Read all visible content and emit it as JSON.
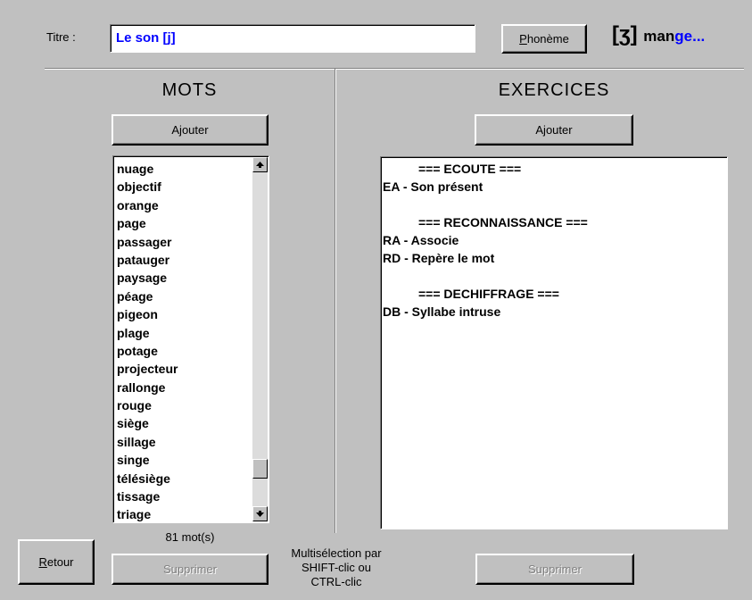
{
  "header": {
    "title_label": "Titre :",
    "title_value": "Le son [j]",
    "phoneme_button": "Phonème",
    "phoneme_symbol": "[ʒ]",
    "example_word_prefix": "man",
    "example_word_highlight": "ge...",
    "highlight_color": "#0000ff"
  },
  "mots": {
    "heading": "MOTS",
    "add_button": "Ajouter",
    "words": [
      "nuage",
      "objectif",
      "orange",
      "page",
      "passager",
      "patauger",
      "paysage",
      "péage",
      "pigeon",
      "plage",
      "potage",
      "projecteur",
      "rallonge",
      "rouge",
      "siège",
      "sillage",
      "singe",
      "télésiège",
      "tissage",
      "triage"
    ],
    "count": "81 mot(s)",
    "delete_button": "Supprimer"
  },
  "exercices": {
    "heading": "EXERCICES",
    "add_button": "Ajouter",
    "lines": [
      "=== ECOUTE ===",
      "EA - Son présent",
      "=== RECONNAISSANCE ===",
      "RA - Associe",
      "RD - Repère le mot",
      "=== DECHIFFRAGE ===",
      "DB - Syllabe intruse"
    ],
    "delete_button": "Supprimer"
  },
  "footer": {
    "back_button": "Retour",
    "hint_line1": "Multisélection par",
    "hint_line2": "SHIFT-clic ou",
    "hint_line3": "CTRL-clic"
  }
}
